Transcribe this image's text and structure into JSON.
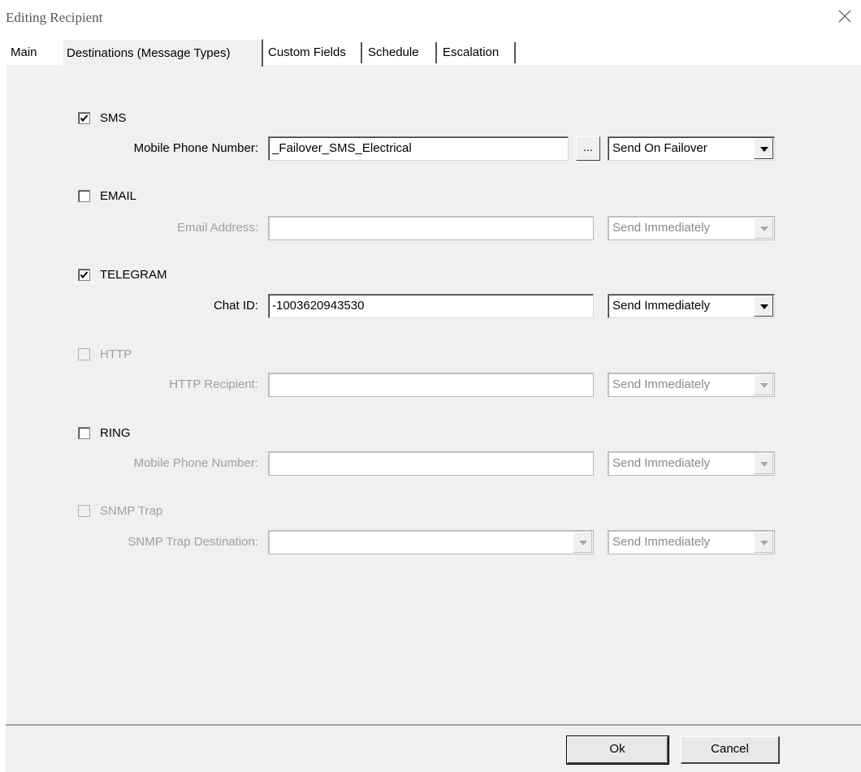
{
  "window": {
    "title": "Editing Recipient",
    "close_icon": "close-icon"
  },
  "tabs": [
    {
      "label": "Main"
    },
    {
      "label": "Destinations (Message Types)"
    },
    {
      "label": "Custom Fields"
    },
    {
      "label": "Schedule"
    },
    {
      "label": "Escalation"
    }
  ],
  "destinations": {
    "sms": {
      "label": "SMS",
      "checked": true,
      "field_label": "Mobile Phone Number:",
      "value": "_Failover_SMS_Electrical",
      "browse_label": "...",
      "mode": "Send On Failover"
    },
    "email": {
      "label": "EMAIL",
      "checked": false,
      "field_label": "Email Address:",
      "value": "",
      "mode": "Send Immediately"
    },
    "telegram": {
      "label": "TELEGRAM",
      "checked": true,
      "field_label": "Chat ID:",
      "value": "-1003620943530",
      "mode": "Send Immediately"
    },
    "http": {
      "label": "HTTP",
      "checked": false,
      "field_label": "HTTP Recipient:",
      "value": "",
      "mode": "Send Immediately"
    },
    "ring": {
      "label": "RING",
      "checked": false,
      "field_label": "Mobile Phone Number:",
      "value": "",
      "mode": "Send Immediately"
    },
    "snmp": {
      "label": "SNMP Trap",
      "checked": false,
      "field_label": "SNMP Trap Destination:",
      "value": "",
      "mode": "Send Immediately"
    }
  },
  "footer": {
    "ok_label": "Ok",
    "cancel_label": "Cancel"
  }
}
